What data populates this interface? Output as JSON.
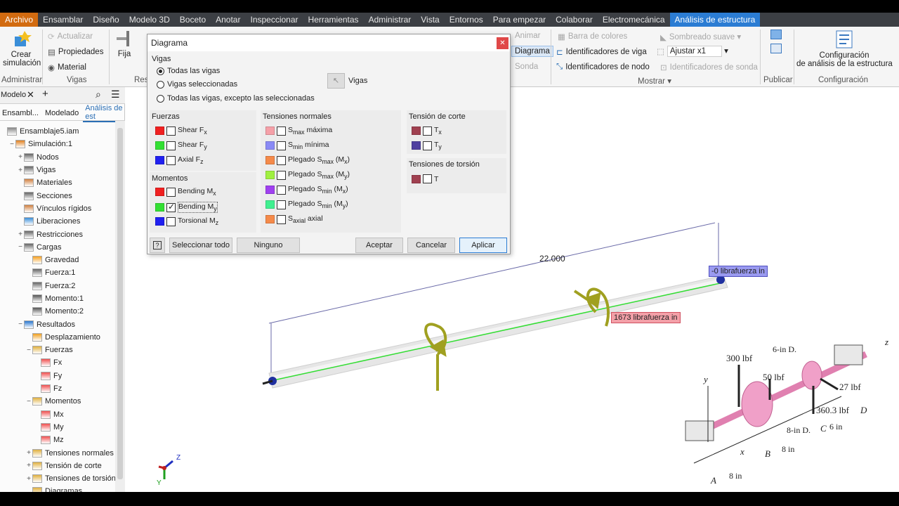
{
  "menu": [
    "Archivo",
    "Ensamblar",
    "Diseño",
    "Modelo 3D",
    "Boceto",
    "Anotar",
    "Inspeccionar",
    "Herramientas",
    "Administrar",
    "Vista",
    "Entornos",
    "Para empezar",
    "Colaborar",
    "Electromecánica",
    "Análisis de estructura"
  ],
  "ribbon": {
    "crear_simulacion": "Crear simulación",
    "crear_line1": "Crear",
    "crear_line2": "simulación",
    "actualizar": "Actualizar",
    "propiedades": "Propiedades",
    "material": "Material",
    "fija": "Fija",
    "group_administrar": "Administrar",
    "group_vigas": "Vigas",
    "group_res": "Res",
    "animar": "Animar",
    "diagrama": "Diagrama",
    "sonda": "Sonda",
    "barra_colores": "Barra de colores",
    "identificadores_viga": "Identificadores de viga",
    "identificadores_nodo": "Identificadores de nodo",
    "sombreado_suave": "Sombreado suave",
    "ajustar": "Ajustar x1",
    "identificadores_sonda": "Identificadores de sonda",
    "group_mostrar": "Mostrar",
    "publicar": "Publicar",
    "config_line1": "Configuración",
    "config_line2": "de análisis de la estructura",
    "group_configuracion": "Configuración"
  },
  "left": {
    "tab_modelo": "Modelo",
    "tabs": [
      "Ensambl...",
      "Modelado",
      "Análisis de est"
    ],
    "tree": [
      {
        "label": "Ensamblaje5.iam",
        "indent": 0,
        "pm": ""
      },
      {
        "label": "Simulación:1",
        "indent": 1,
        "pm": "−"
      },
      {
        "label": "Nodos",
        "indent": 2,
        "pm": "+"
      },
      {
        "label": "Vigas",
        "indent": 2,
        "pm": "+"
      },
      {
        "label": "Materiales",
        "indent": 2,
        "pm": ""
      },
      {
        "label": "Secciones",
        "indent": 2,
        "pm": ""
      },
      {
        "label": "Vínculos rígidos",
        "indent": 2,
        "pm": ""
      },
      {
        "label": "Liberaciones",
        "indent": 2,
        "pm": ""
      },
      {
        "label": "Restricciones",
        "indent": 2,
        "pm": "+"
      },
      {
        "label": "Cargas",
        "indent": 2,
        "pm": "−"
      },
      {
        "label": "Gravedad",
        "indent": 3,
        "pm": ""
      },
      {
        "label": "Fuerza:1",
        "indent": 3,
        "pm": ""
      },
      {
        "label": "Fuerza:2",
        "indent": 3,
        "pm": ""
      },
      {
        "label": "Momento:1",
        "indent": 3,
        "pm": ""
      },
      {
        "label": "Momento:2",
        "indent": 3,
        "pm": ""
      },
      {
        "label": "Resultados",
        "indent": 2,
        "pm": "−"
      },
      {
        "label": "Desplazamiento",
        "indent": 3,
        "pm": ""
      },
      {
        "label": "Fuerzas",
        "indent": 3,
        "pm": "−"
      },
      {
        "label": "Fx",
        "indent": 4,
        "pm": ""
      },
      {
        "label": "Fy",
        "indent": 4,
        "pm": ""
      },
      {
        "label": "Fz",
        "indent": 4,
        "pm": ""
      },
      {
        "label": "Momentos",
        "indent": 3,
        "pm": "−"
      },
      {
        "label": "Mx",
        "indent": 4,
        "pm": ""
      },
      {
        "label": "My",
        "indent": 4,
        "pm": ""
      },
      {
        "label": "Mz",
        "indent": 4,
        "pm": ""
      },
      {
        "label": "Tensiones normales",
        "indent": 3,
        "pm": "+"
      },
      {
        "label": "Tensión de corte",
        "indent": 3,
        "pm": "+"
      },
      {
        "label": "Tensiones de torsión",
        "indent": 3,
        "pm": "+"
      },
      {
        "label": "Diagramas",
        "indent": 3,
        "pm": ""
      }
    ]
  },
  "dialog": {
    "title": "Diagrama",
    "vigas_label": "Vigas",
    "radio_todas": "Todas las vigas",
    "radio_seleccionadas": "Vigas seleccionadas",
    "radio_excepto": "Todas las vigas, excepto las seleccionadas",
    "vigas_button": "Vigas",
    "fuerzas_label": "Fuerzas",
    "momentos_label": "Momentos",
    "tensiones_normales_label": "Tensiones normales",
    "tension_corte_label": "Tensión de corte",
    "tensiones_torsion_label": "Tensiones de torsión",
    "btn_seleccionar": "Seleccionar todo",
    "btn_ninguno": "Ninguno",
    "btn_aceptar": "Aceptar",
    "btn_cancelar": "Cancelar",
    "btn_aplicar": "Aplicar",
    "colors": {
      "red": "#f02020",
      "green": "#33e033",
      "blue": "#2020f0",
      "pink": "#f5a0a8",
      "lavender": "#8a8af5",
      "orange": "#f58a4a",
      "lime": "#a0f040",
      "purple": "#a040f0",
      "mint": "#40f090",
      "maroon": "#a04050",
      "indigo": "#5040a0"
    }
  },
  "view": {
    "dimension": "22.000",
    "tag_neg": "-0 librafuerza in",
    "tag_pos": "1673 librafuerza in",
    "axis_z": "Z",
    "axis_y": "Y",
    "fig_300": "300 lbf",
    "fig_50": "50 lbf",
    "fig_6ind": "6-in D.",
    "fig_27": "27 lbf",
    "fig_3603": "360.3 lbf",
    "fig_D": "D",
    "fig_8ind": "8-in D.",
    "fig_C": "C",
    "fig_6in": "6 in",
    "fig_8in1": "8 in",
    "fig_B": "B",
    "fig_8in2": "8 in",
    "fig_A": "A",
    "fig_x": "x",
    "fig_y": "y",
    "fig_z": "z"
  }
}
